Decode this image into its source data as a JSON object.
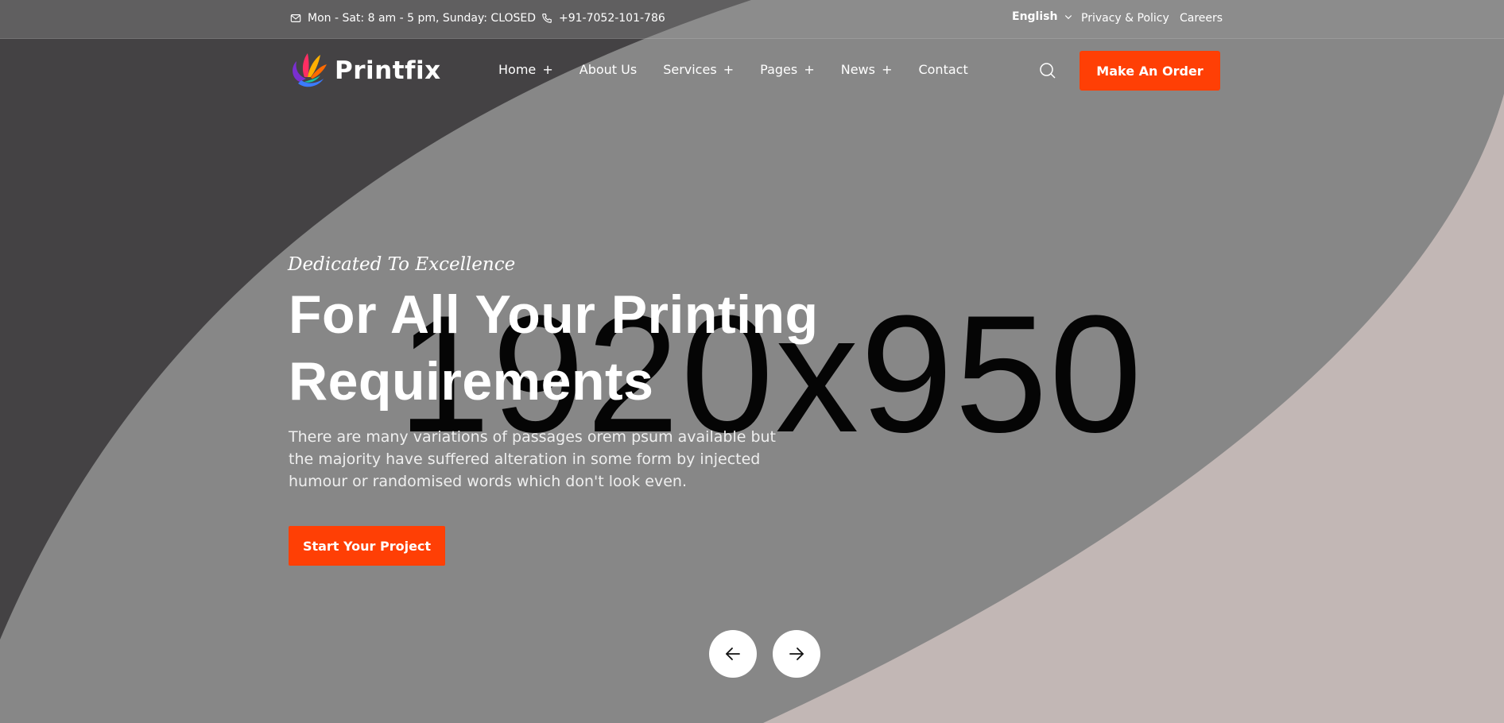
{
  "topbar": {
    "hours": "Mon - Sat: 8 am - 5 pm, Sunday: CLOSED",
    "phone": "+91-7052-101-786",
    "language": "English",
    "privacy_link": "Privacy & Policy",
    "careers_link": "Careers"
  },
  "header": {
    "brand": "Printfix",
    "nav": [
      {
        "label": "Home",
        "has_submenu": true
      },
      {
        "label": "About Us",
        "has_submenu": false
      },
      {
        "label": "Services",
        "has_submenu": true
      },
      {
        "label": "Pages",
        "has_submenu": true
      },
      {
        "label": "News",
        "has_submenu": true
      },
      {
        "label": "Contact",
        "has_submenu": false
      }
    ],
    "submenu_marker": "+",
    "search_icon": "search-icon",
    "cta": "Make An Order"
  },
  "hero": {
    "placeholder_size": "1920x950",
    "tagline": "Dedicated To Excellence",
    "headline_line1": "For All Your Printing",
    "headline_line2": "Requirements",
    "description": "There are many variations of passages orem psum available but the majority have suffered alteration in some form by injected humour or randomised words which don't look even.",
    "cta": "Start Your Project",
    "prev_icon": "arrow-left-icon",
    "next_icon": "arrow-right-icon"
  },
  "colors": {
    "accent": "#ff3f05",
    "background": "#878787",
    "dark_shape": "#444244",
    "light_shape": "#c2b7b5"
  }
}
